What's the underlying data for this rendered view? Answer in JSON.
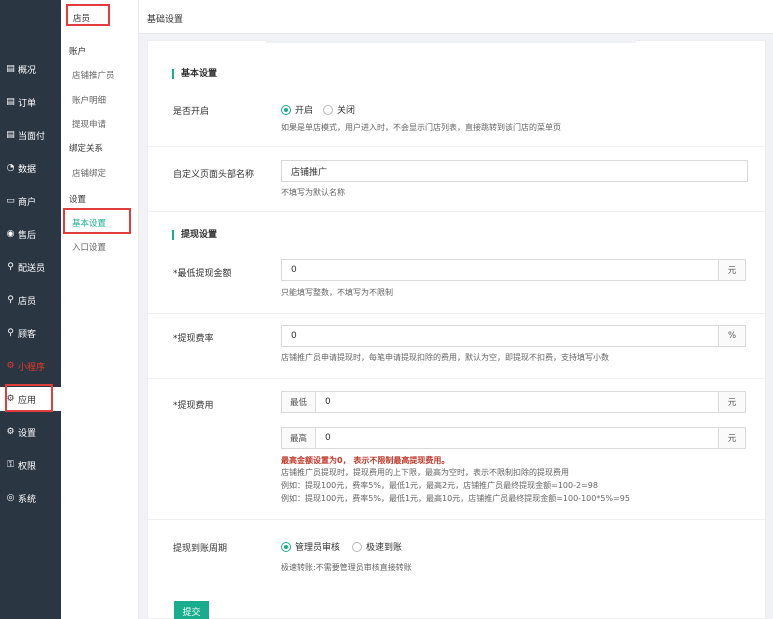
{
  "sidebar": {
    "items": [
      {
        "icon": "▤",
        "label": "概况"
      },
      {
        "icon": "▤",
        "label": "订单"
      },
      {
        "icon": "▤",
        "label": "当面付"
      },
      {
        "icon": "◔",
        "label": "数据"
      },
      {
        "icon": "▭",
        "label": "商户"
      },
      {
        "icon": "◉",
        "label": "售后"
      },
      {
        "icon": "⚲",
        "label": "配送员"
      },
      {
        "icon": "⚲",
        "label": "店员"
      },
      {
        "icon": "⚲",
        "label": "顾客"
      },
      {
        "icon": "⚙",
        "label": "小程序"
      },
      {
        "icon": "⚙",
        "label": "应用"
      },
      {
        "icon": "⚙",
        "label": "设置"
      },
      {
        "icon": "⚿",
        "label": "权限"
      },
      {
        "icon": "◎",
        "label": "系统"
      }
    ]
  },
  "submenu": {
    "title": "店员",
    "group_account": "账户",
    "promoter": "店铺推广员",
    "account_detail": "账户明细",
    "withdraw_apply": "提现申请",
    "group_binding": "绑定关系",
    "shop_binding": "店铺绑定",
    "group_settings": "设置",
    "basic_settings": "基本设置",
    "entry_settings": "入口设置"
  },
  "header": {
    "title": "基础设置"
  },
  "form": {
    "section_basic": "基本设置",
    "enable_label": "是否开启",
    "enable_on": "开启",
    "enable_off": "关闭",
    "enable_hint": "如果是单店模式，用户进入时，不会显示门店列表，直接跳转到该门店的菜单页",
    "custom_title_label": "自定义页面头部名称",
    "custom_title_value": "店铺推广",
    "custom_title_hint": "不填写为默认名称",
    "section_withdraw": "提现设置",
    "min_amount_label": "*最低提现金额",
    "min_amount_value": "0",
    "min_amount_unit": "元",
    "min_amount_hint": "只能填写整数，不填写为不限制",
    "fee_rate_label": "*提现费率",
    "fee_rate_value": "0",
    "fee_rate_unit": "%",
    "fee_rate_hint": "店铺推广员申请提现时，每笔申请提现扣除的费用，默认为空，即提现不扣费，支持填写小数",
    "fee_label": "*提现费用",
    "fee_min_prefix": "最低",
    "fee_min_value": "0",
    "fee_min_unit": "元",
    "fee_max_prefix": "最高",
    "fee_max_value": "0",
    "fee_max_unit": "元",
    "fee_warn": "最高金额设置为0，  表示不限制最高提现费用。",
    "fee_hint1": "店铺推广员提现时，提现费用的上下限，最高为空时，表示不限制扣除的提现费用",
    "fee_hint2": "例如：提现100元，费率5%，最低1元，最高2元，店铺推广员最终提现金额=100-2=98",
    "fee_hint3": "例如：提现100元，费率5%，最低1元，最高10元，店铺推广员最终提现金额=100-100*5%=95",
    "period_label": "提现到账周期",
    "period_admin": "管理员审核",
    "period_fast": "极速到账",
    "period_hint": "极速转账:不需要管理员审核直接转账",
    "submit": "提交"
  }
}
